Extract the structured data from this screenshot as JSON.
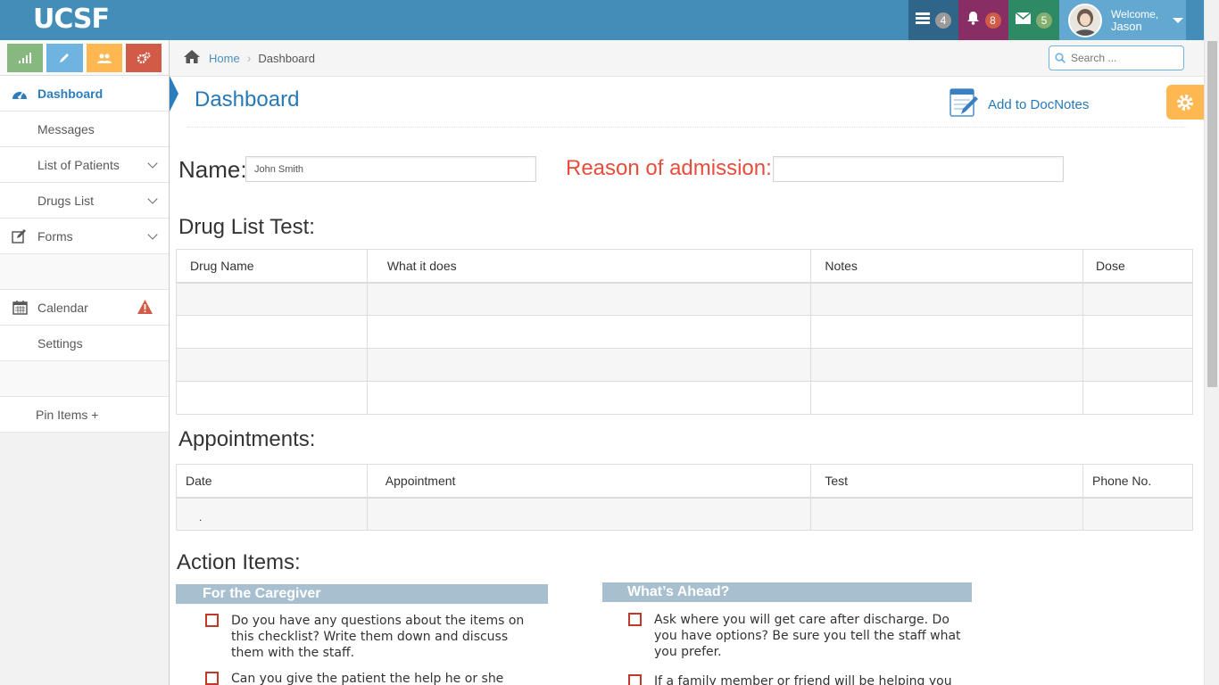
{
  "navbar": {
    "logo": "UCSF",
    "tasks_count": "4",
    "notifications_count": "8",
    "messages_count": "5",
    "welcome": "Welcome,",
    "user_name": "Jason"
  },
  "sidebar": {
    "items": [
      {
        "label": "Dashboard"
      },
      {
        "label": "Messages"
      },
      {
        "label": "List of Patients"
      },
      {
        "label": "Drugs List"
      },
      {
        "label": "Forms"
      },
      {
        "label": ""
      },
      {
        "label": "Calendar"
      },
      {
        "label": "Settings"
      },
      {
        "label": ""
      },
      {
        "label": "Pin Items +"
      }
    ]
  },
  "breadcrumb": {
    "home": "Home",
    "current": "Dashboard"
  },
  "search": {
    "placeholder": "Search ..."
  },
  "header": {
    "title": "Dashboard",
    "docnotes": "Add to DocNotes"
  },
  "form": {
    "name_label": "Name:",
    "name_value": "John Smith",
    "reason_label": "Reason of admission:",
    "reason_value": ""
  },
  "drug_list": {
    "title": "Drug List Test:",
    "columns": [
      "Drug Name",
      "What it does",
      "Notes",
      "Dose"
    ]
  },
  "appointments": {
    "title": "Appointments:",
    "columns": [
      "Date",
      "Appointment",
      "Test",
      "Phone No."
    ],
    "first_cell": "."
  },
  "action_items": {
    "title": "Action Items:",
    "caregiver": {
      "heading": "For the Caregiver",
      "items": [
        "Do you have any questions about the items on this checklist? Write them down and discuss them with the staff.",
        "Can you give the patient the help he or she needs?"
      ]
    },
    "ahead": {
      "heading": "What’s Ahead?",
      "items": [
        "Ask where you will get care after discharge. Do you have options? Be sure you tell the staff what you prefer.",
        "If a family member or friend will be helping you after"
      ]
    }
  },
  "colors": {
    "navbar": "#438eb9",
    "accent": "#2679b5",
    "reason_label": "#e74c3c",
    "checkbox": "#c0392b"
  }
}
